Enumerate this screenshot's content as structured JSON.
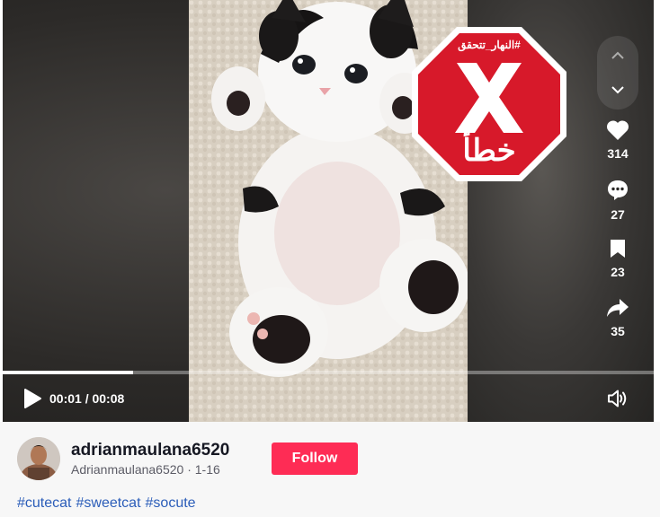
{
  "video": {
    "current_time": "00:01",
    "duration": "00:08",
    "time_display": "00:01 / 00:08",
    "progress_fraction": 0.2,
    "subject_icon": "kitten-photo"
  },
  "stamp": {
    "hashtag": "#النهار_تتحقق",
    "verdict": "خطأ",
    "color": "#d7192a",
    "icon": "x-octagon-icon"
  },
  "actions": {
    "likes": "314",
    "comments": "27",
    "saves": "23",
    "shares": "35"
  },
  "author": {
    "username": "adrianmaulana6520",
    "subline": "Adrianmaulana6520 · 1-16",
    "follow_label": "Follow"
  },
  "hashtags": [
    "#cutecat",
    "#sweetcat",
    "#socute"
  ],
  "colors": {
    "follow": "#fe2c55",
    "hashtag": "#2b5db9",
    "player_bg": "#2a2826"
  }
}
